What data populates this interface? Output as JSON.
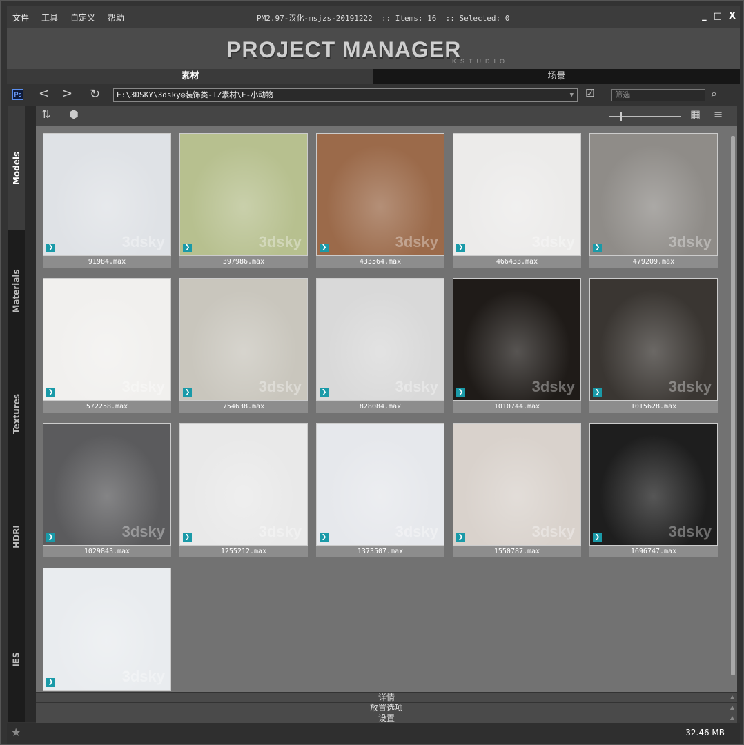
{
  "menu": [
    "文件",
    "工具",
    "自定义",
    "帮助"
  ],
  "title": "PM2.97-汉化-msjzs-20191222  :: Items: 16  :: Selected: 0",
  "window_controls": {
    "minimize": "_",
    "maximize": "□",
    "close": "X"
  },
  "logo": {
    "title": "PROJECT MANAGER",
    "subtitle": "KSTUDIO"
  },
  "tabs": [
    "素材",
    "场景"
  ],
  "toolbar": {
    "ps": "Ps",
    "path": "E:\\3DSKY\\3dsky◎装饰类-TZ素材\\F-小动物",
    "filter_placeholder": "筛选"
  },
  "sidebar": [
    "Models",
    "Materials",
    "Textures",
    "HDRI",
    "IES"
  ],
  "watermark": "3dsky",
  "items": [
    {
      "name": "91984.max",
      "color": "#dfe2e6"
    },
    {
      "name": "397986.max",
      "color": "#b7c08f"
    },
    {
      "name": "433564.max",
      "color": "#9b6a4a"
    },
    {
      "name": "466433.max",
      "color": "#ecebea"
    },
    {
      "name": "479209.max",
      "color": "#8f8c88"
    },
    {
      "name": "572258.max",
      "color": "#f1f0ee"
    },
    {
      "name": "754638.max",
      "color": "#c9c6bd"
    },
    {
      "name": "828084.max",
      "color": "#d9d9d9"
    },
    {
      "name": "1010744.max",
      "color": "#1f1b18"
    },
    {
      "name": "1015628.max",
      "color": "#3a3632"
    },
    {
      "name": "1029843.max",
      "color": "#5b5b5d"
    },
    {
      "name": "1255212.max",
      "color": "#e9e9e9"
    },
    {
      "name": "1373507.max",
      "color": "#e6e8ec"
    },
    {
      "name": "1550787.max",
      "color": "#d9d2cc"
    },
    {
      "name": "1696747.max",
      "color": "#1e1e1e"
    },
    {
      "name": "",
      "color": "#e9ecef"
    }
  ],
  "panels": [
    "详情",
    "放置选项",
    "设置"
  ],
  "status": {
    "size": "32.46 MB"
  }
}
